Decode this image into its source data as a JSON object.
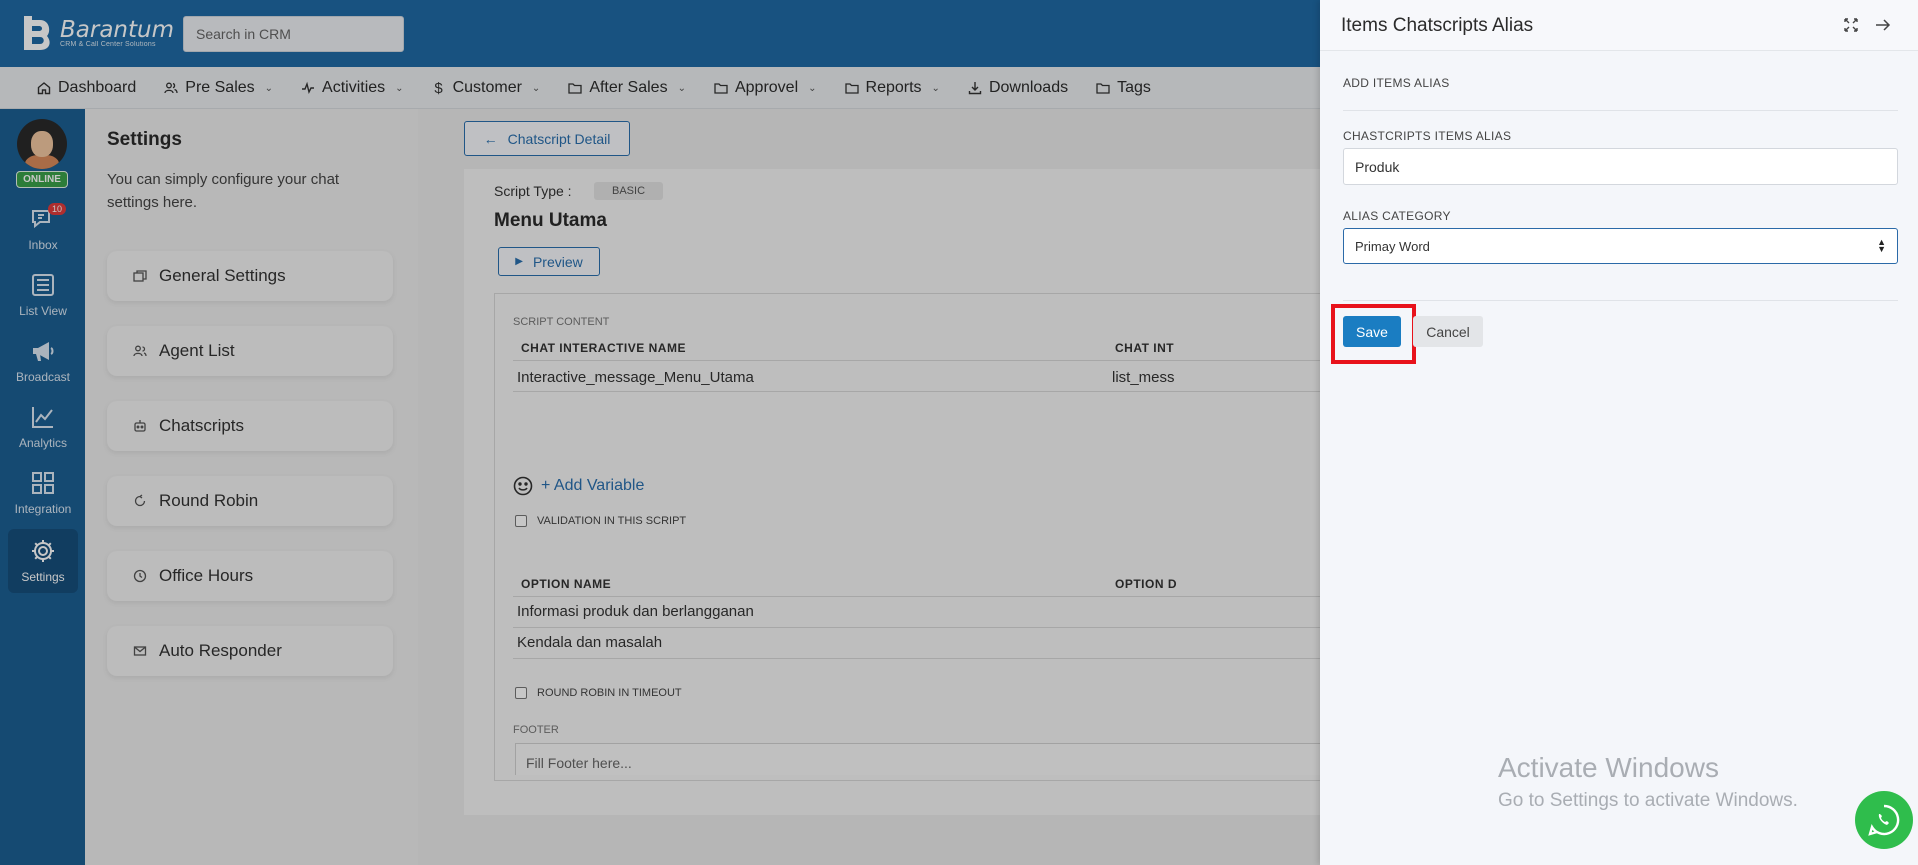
{
  "header": {
    "brand_name": "Barantum",
    "brand_tagline": "CRM & Call Center Solutions",
    "search_placeholder": "Search in CRM"
  },
  "nav": [
    {
      "label": "Dashboard",
      "icon": "home-icon"
    },
    {
      "label": "Pre Sales",
      "icon": "users-icon"
    },
    {
      "label": "Activities",
      "icon": "activity-icon"
    },
    {
      "label": "Customer",
      "icon": "dollar-icon"
    },
    {
      "label": "After Sales",
      "icon": "folder-icon"
    },
    {
      "label": "Approvel",
      "icon": "folder-icon"
    },
    {
      "label": "Reports",
      "icon": "folder-icon"
    },
    {
      "label": "Downloads",
      "icon": "download-icon"
    },
    {
      "label": "Tags",
      "icon": "folder-icon"
    }
  ],
  "rail": {
    "status": "ONLINE",
    "inbox_count": "10",
    "items": [
      {
        "label": "Inbox",
        "icon": "chat-icon"
      },
      {
        "label": "List View",
        "icon": "list-icon"
      },
      {
        "label": "Broadcast",
        "icon": "megaphone-icon"
      },
      {
        "label": "Analytics",
        "icon": "chart-icon"
      },
      {
        "label": "Integration",
        "icon": "grid-icon"
      },
      {
        "label": "Settings",
        "icon": "gear-icon"
      }
    ]
  },
  "settings": {
    "title": "Settings",
    "description": "You can simply configure your chat settings here.",
    "items": [
      {
        "label": "General Settings",
        "icon": "windows-icon"
      },
      {
        "label": "Agent List",
        "icon": "users-icon"
      },
      {
        "label": "Chatscripts",
        "icon": "robot-icon"
      },
      {
        "label": "Round Robin",
        "icon": "refresh-icon"
      },
      {
        "label": "Office Hours",
        "icon": "clock-icon"
      },
      {
        "label": "Auto Responder",
        "icon": "mail-icon"
      }
    ]
  },
  "main": {
    "back_label": "Chatscript Detail",
    "script_type_label": "Script Type :",
    "script_type_value": "BASIC",
    "menu_title": "Menu Utama",
    "preview_label": "Preview",
    "script_content_label": "SCRIPT CONTENT",
    "table1": {
      "headers": [
        "CHAT INTERACTIVE NAME",
        "CHAT INT"
      ],
      "row": [
        "Interactive_message_Menu_Utama",
        "list_mess"
      ]
    },
    "add_variable": "+ Add Variable",
    "validation_label": "VALIDATION IN THIS SCRIPT",
    "table2": {
      "headers": [
        "OPTION NAME",
        "OPTION D"
      ],
      "rows": [
        "Informasi produk dan berlangganan",
        "Kendala dan masalah"
      ]
    },
    "round_robin_label": "ROUND ROBIN IN TIMEOUT",
    "footer_label": "FOOTER",
    "footer_placeholder": "Fill Footer here..."
  },
  "drawer": {
    "title": "Items Chatscripts Alias",
    "section_title": "ADD ITEMS ALIAS",
    "alias_label": "CHASTCRIPTS ITEMS ALIAS",
    "alias_value": "Produk",
    "category_label": "ALIAS CATEGORY",
    "category_value": "Primay Word",
    "save_label": "Save",
    "cancel_label": "Cancel"
  },
  "watermark": {
    "line1": "Activate Windows",
    "line2": "Go to Settings to activate Windows."
  },
  "colors": {
    "brand": "#1f6aa5",
    "primary_button": "#1a7dc2",
    "highlight": "#e8121b",
    "whatsapp": "#2fbd4c"
  }
}
